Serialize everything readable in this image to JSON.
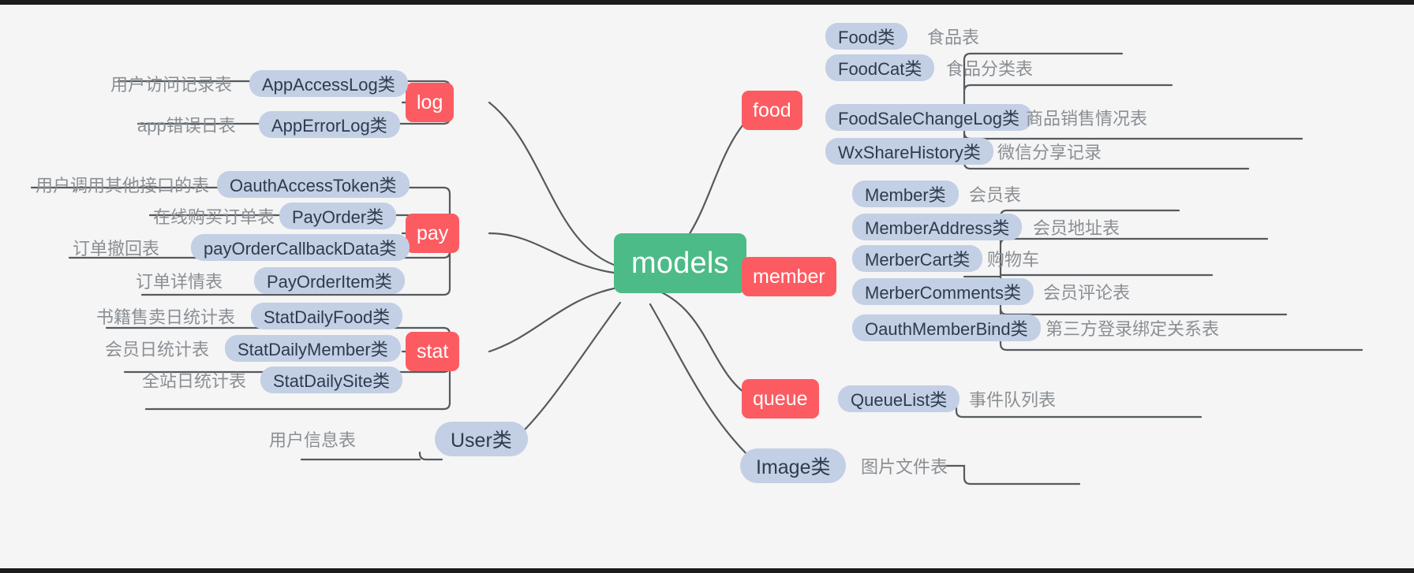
{
  "diagram": {
    "title": "models",
    "root": {
      "label": "models",
      "color": "#4cbb87"
    },
    "category_color": "#fc5b62",
    "leaf_color": "#c3cfe4",
    "background": "#f5f5f5",
    "edge_color": "#555a5e",
    "branches": [
      {
        "id": "log",
        "label": "log",
        "side": "left",
        "items": [
          {
            "cls": "AppAccessLog类",
            "desc": "用户访问记录表"
          },
          {
            "cls": "AppErrorLog类",
            "desc": "app错误日表"
          }
        ]
      },
      {
        "id": "pay",
        "label": "pay",
        "side": "left",
        "items": [
          {
            "cls": "OauthAccessToken类",
            "desc": "用户调用其他接口的表"
          },
          {
            "cls": "PayOrder类",
            "desc": "在线购买订单表"
          },
          {
            "cls": "payOrderCallbackData类",
            "desc": "订单撤回表"
          },
          {
            "cls": "PayOrderItem类",
            "desc": "订单详情表"
          }
        ]
      },
      {
        "id": "stat",
        "label": "stat",
        "side": "left",
        "items": [
          {
            "cls": "StatDailyFood类",
            "desc": "书籍售卖日统计表"
          },
          {
            "cls": "StatDailyMember类",
            "desc": "会员日统计表"
          },
          {
            "cls": "StatDailySite类",
            "desc": "全站日统计表"
          }
        ]
      },
      {
        "id": "user",
        "label": "User类",
        "side": "left",
        "leaf_direct": true,
        "items": [
          {
            "cls": "User类",
            "desc": "用户信息表"
          }
        ]
      },
      {
        "id": "food",
        "label": "food",
        "side": "right",
        "items": [
          {
            "cls": "Food类",
            "desc": "食品表"
          },
          {
            "cls": "FoodCat类",
            "desc": "食品分类表"
          },
          {
            "cls": "FoodSaleChangeLog类",
            "desc": "商品销售情况表"
          },
          {
            "cls": "WxShareHistory类",
            "desc": "微信分享记录"
          }
        ]
      },
      {
        "id": "member",
        "label": "member",
        "side": "right",
        "items": [
          {
            "cls": "Member类",
            "desc": "会员表"
          },
          {
            "cls": "MemberAddress类",
            "desc": "会员地址表"
          },
          {
            "cls": "MerberCart类",
            "desc": "购物车"
          },
          {
            "cls": "MerberComments类",
            "desc": "会员评论表"
          },
          {
            "cls": "OauthMemberBind类",
            "desc": "第三方登录绑定关系表"
          }
        ]
      },
      {
        "id": "queue",
        "label": "queue",
        "side": "right",
        "items": [
          {
            "cls": "QueueList类",
            "desc": "事件队列表"
          }
        ]
      },
      {
        "id": "image",
        "label": "Image类",
        "side": "right",
        "leaf_direct": true,
        "items": [
          {
            "cls": "Image类",
            "desc": "图片文件表"
          }
        ]
      }
    ]
  },
  "labels": {
    "root": "models",
    "cat_log": "log",
    "cat_pay": "pay",
    "cat_stat": "stat",
    "cat_food": "food",
    "cat_member": "member",
    "cat_queue": "queue",
    "leaf_user": "User类",
    "leaf_image": "Image类",
    "log_1_cls": "AppAccessLog类",
    "log_1_desc": "用户访问记录表",
    "log_2_cls": "AppErrorLog类",
    "log_2_desc": "app错误日表",
    "pay_1_cls": "OauthAccessToken类",
    "pay_1_desc": "用户调用其他接口的表",
    "pay_2_cls": "PayOrder类",
    "pay_2_desc": "在线购买订单表",
    "pay_3_cls": "payOrderCallbackData类",
    "pay_3_desc": "订单撤回表",
    "pay_4_cls": "PayOrderItem类",
    "pay_4_desc": "订单详情表",
    "stat_1_cls": "StatDailyFood类",
    "stat_1_desc": "书籍售卖日统计表",
    "stat_2_cls": "StatDailyMember类",
    "stat_2_desc": "会员日统计表",
    "stat_3_cls": "StatDailySite类",
    "stat_3_desc": "全站日统计表",
    "user_desc": "用户信息表",
    "food_1_cls": "Food类",
    "food_1_desc": "食品表",
    "food_2_cls": "FoodCat类",
    "food_2_desc": "食品分类表",
    "food_3_cls": "FoodSaleChangeLog类",
    "food_3_desc": "商品销售情况表",
    "food_4_cls": "WxShareHistory类",
    "food_4_desc": "微信分享记录",
    "member_1_cls": "Member类",
    "member_1_desc": "会员表",
    "member_2_cls": "MemberAddress类",
    "member_2_desc": "会员地址表",
    "member_3_cls": "MerberCart类",
    "member_3_desc": "购物车",
    "member_4_cls": "MerberComments类",
    "member_4_desc": "会员评论表",
    "member_5_cls": "OauthMemberBind类",
    "member_5_desc": "第三方登录绑定关系表",
    "queue_1_cls": "QueueList类",
    "queue_1_desc": "事件队列表",
    "image_desc": "图片文件表"
  }
}
